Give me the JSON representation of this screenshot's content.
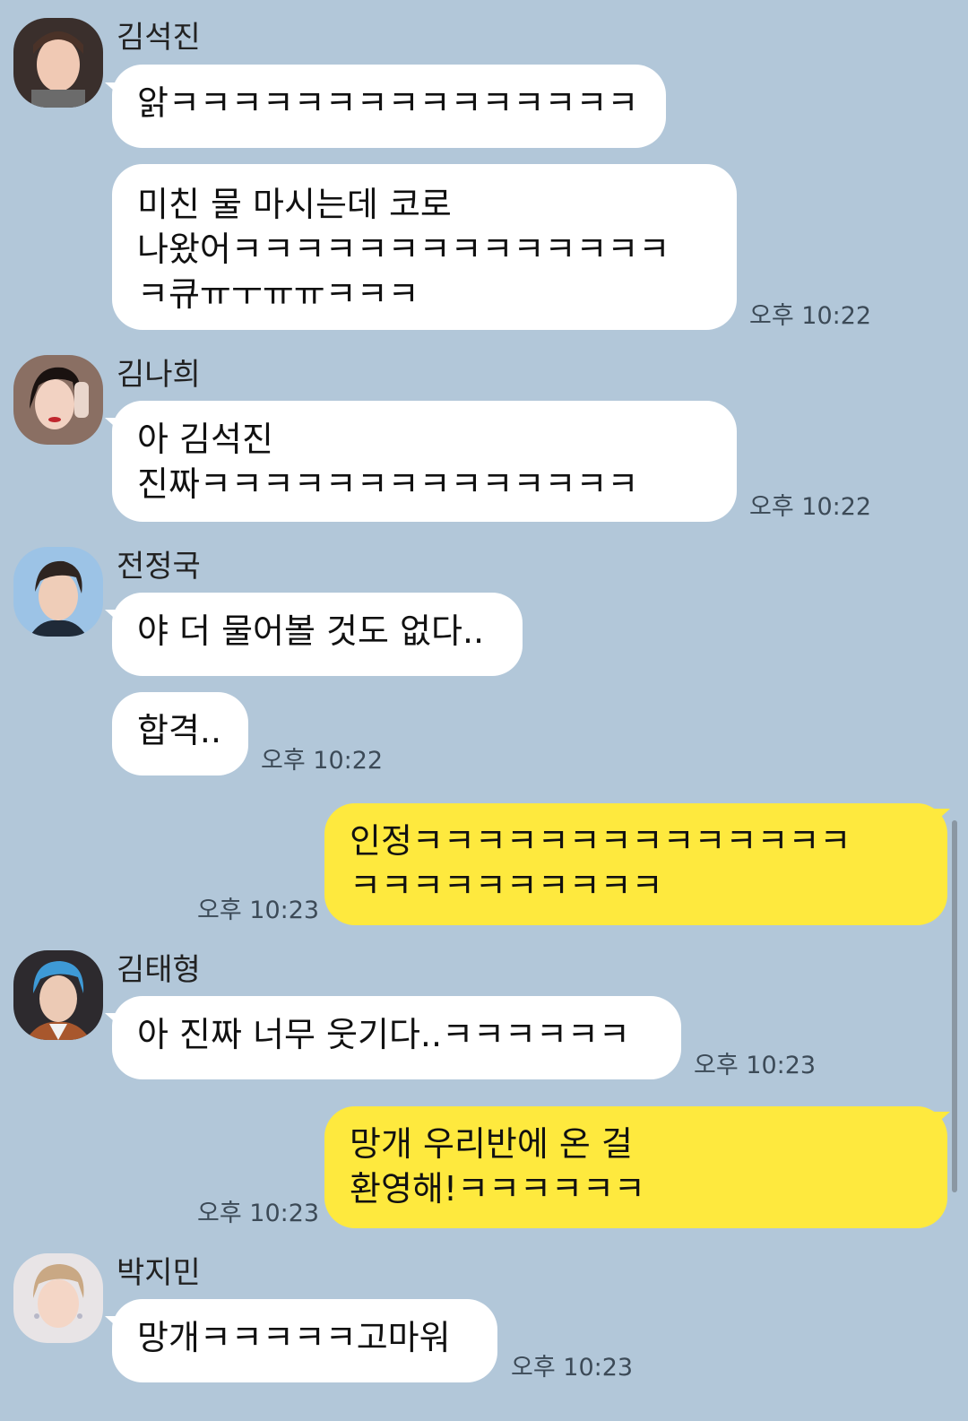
{
  "messages": [
    {
      "sender": "김석진",
      "text": "앍ㅋㅋㅋㅋㅋㅋㅋㅋㅋㅋㅋㅋㅋㅋㅋ",
      "time": ""
    },
    {
      "sender": "",
      "text": "미친 물 마시는데 코로\n나왔어ㅋㅋㅋㅋㅋㅋㅋㅋㅋㅋㅋㅋㅋㅋ\nㅋ큐ㅠㅜㅠㅠㅋㅋㅋ",
      "time": "오후 10:22"
    },
    {
      "sender": "김나희",
      "text": "아 김석진\n진짜ㅋㅋㅋㅋㅋㅋㅋㅋㅋㅋㅋㅋㅋㅋ",
      "time": "오후 10:22"
    },
    {
      "sender": "전정국",
      "text": "야 더 물어볼 것도 없다..",
      "time": ""
    },
    {
      "sender": "",
      "text": "합격..",
      "time": "오후 10:22"
    },
    {
      "sender": "me",
      "text": "인정ㅋㅋㅋㅋㅋㅋㅋㅋㅋㅋㅋㅋㅋㅋ\nㅋㅋㅋㅋㅋㅋㅋㅋㅋㅋ",
      "time": "오후 10:23"
    },
    {
      "sender": "김태형",
      "text": "아 진짜 너무 웃기다..ㅋㅋㅋㅋㅋㅋ",
      "time": "오후 10:23"
    },
    {
      "sender": "me",
      "text": "망개 우리반에 온 걸\n환영해!ㅋㅋㅋㅋㅋㅋ",
      "time": "오후 10:23"
    },
    {
      "sender": "박지민",
      "text": "망개ㅋㅋㅋㅋㅋ고마워",
      "time": "오후 10:23"
    }
  ],
  "colors": {
    "background": "#b2c7d9",
    "incoming_bubble": "#ffffff",
    "outgoing_bubble": "#fee93e",
    "time_text": "#3c4a57"
  }
}
